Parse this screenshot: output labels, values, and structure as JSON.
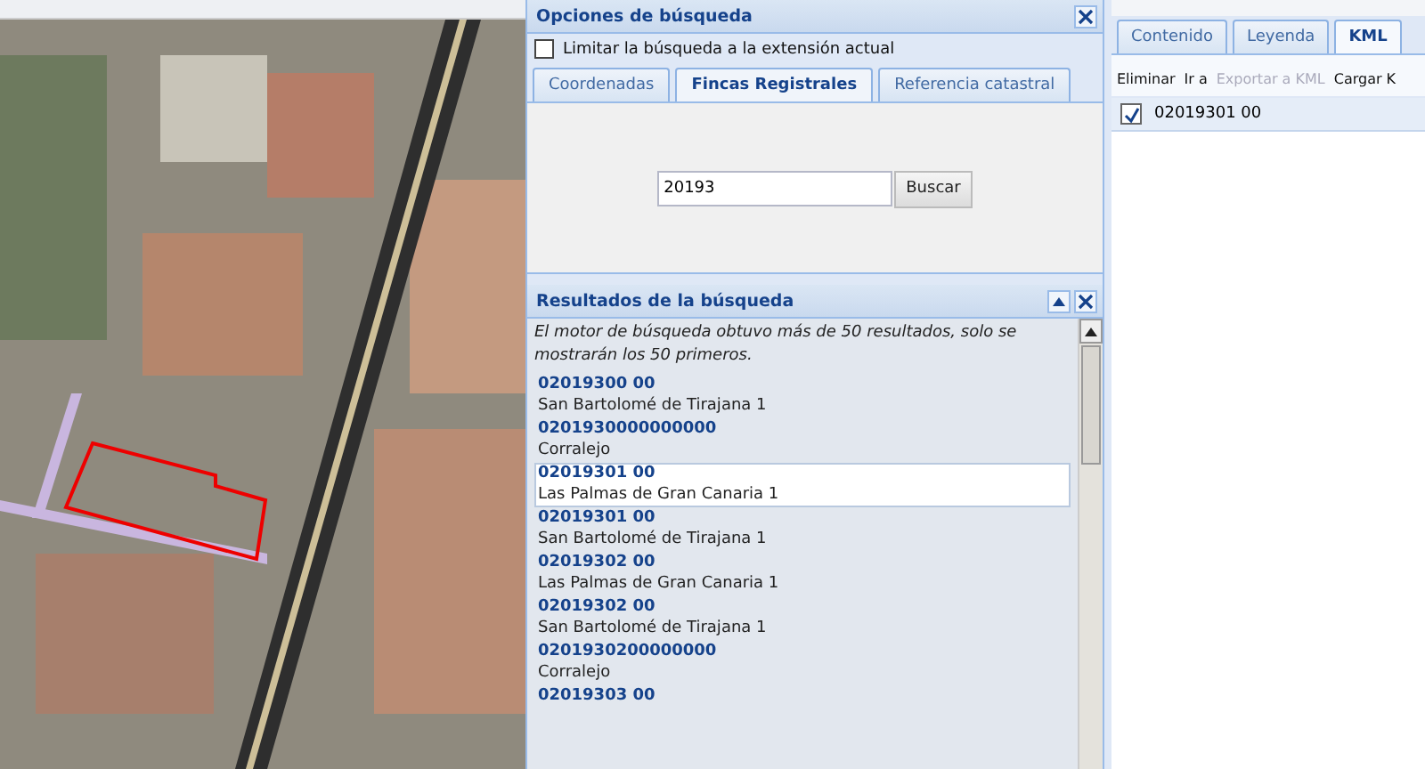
{
  "search_options": {
    "title": "Opciones de búsqueda",
    "limit_to_extent": {
      "label": "Limitar la búsqueda a la extensión actual",
      "checked": false
    },
    "tabs": [
      {
        "label": "Coordenadas",
        "selected": false
      },
      {
        "label": "Fincas Registrales",
        "selected": true
      },
      {
        "label": "Referencia catastral",
        "selected": false
      }
    ],
    "query": {
      "value": "20193"
    },
    "search_button": "Buscar"
  },
  "results": {
    "title": "Resultados de la búsqueda",
    "notice": "El motor de búsqueda obtuvo más de 50 resultados, solo se mostrarán los 50 primeros.",
    "items": [
      {
        "code": "02019300 00",
        "place": "San Bartolomé de Tirajana 1",
        "selected": false
      },
      {
        "code": "0201930000000000",
        "place": "Corralejo",
        "selected": false
      },
      {
        "code": "02019301 00",
        "place": "Las Palmas de Gran Canaria 1",
        "selected": true
      },
      {
        "code": "02019301 00",
        "place": "San Bartolomé de Tirajana 1",
        "selected": false
      },
      {
        "code": "02019302 00",
        "place": "Las Palmas de Gran Canaria 1",
        "selected": false
      },
      {
        "code": "02019302 00",
        "place": "San Bartolomé de Tirajana 1",
        "selected": false
      },
      {
        "code": "0201930200000000",
        "place": "Corralejo",
        "selected": false
      },
      {
        "code": "02019303 00",
        "selected": false
      }
    ]
  },
  "side_panel": {
    "tabs": [
      {
        "label": "Contenido",
        "selected": false
      },
      {
        "label": "Leyenda",
        "selected": false
      },
      {
        "label": "KML",
        "selected": true
      }
    ],
    "toolbar": [
      {
        "label": "Eliminar",
        "disabled": false
      },
      {
        "label": "Ir a",
        "disabled": false
      },
      {
        "label": "Exportar a KML",
        "disabled": true
      },
      {
        "label": "Cargar K",
        "disabled": false
      }
    ],
    "kml_items": [
      {
        "label": "02019301 00",
        "checked": true
      }
    ]
  }
}
